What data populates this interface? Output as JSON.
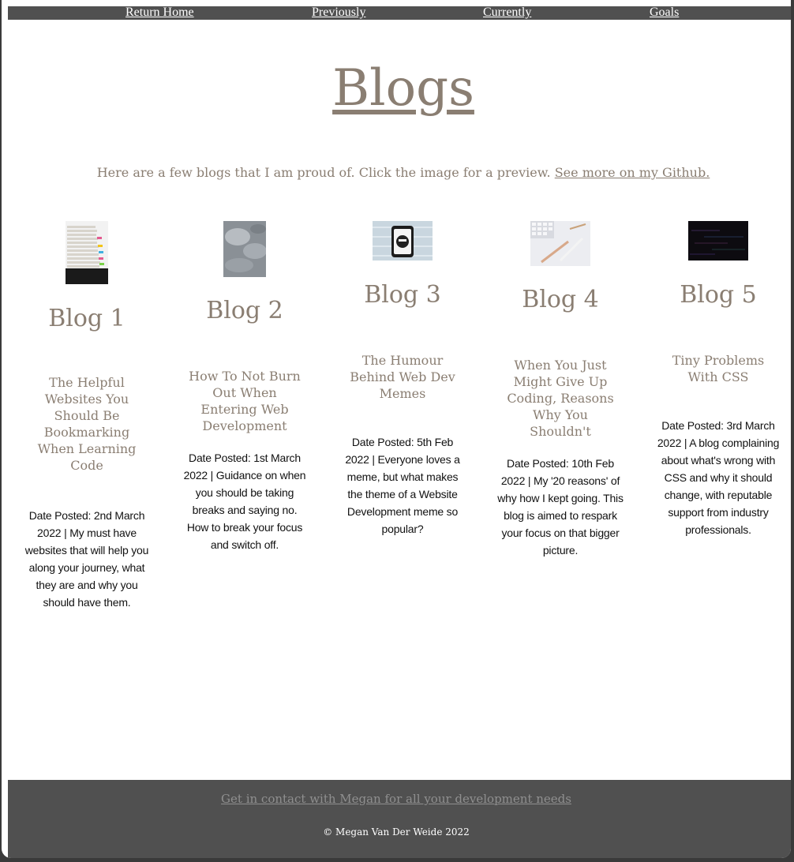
{
  "nav": {
    "home": "Return Home",
    "previously": "Previously",
    "currently": "Currently",
    "goals": "Goals"
  },
  "page": {
    "title": "Blogs",
    "intro": "Here are a few blogs that I am proud of. Click the image for a preview.",
    "github_link": "See more on my Github."
  },
  "blogs": [
    {
      "heading": "Blog 1",
      "title": "The Helpful Websites You Should Be Bookmarking When Learning Code",
      "description": "Date Posted: 2nd March 2022 | My must have websites that will help you along your journey, what they are and why you should have them.",
      "image": "stacked-papers-with-sticky-notes"
    },
    {
      "heading": "Blog 2",
      "title": "How To Not Burn Out When Entering Web Development",
      "description": "Date Posted: 1st March 2022 | Guidance on when you should be taking breaks and saying no. How to break your focus and switch off.",
      "image": "cloudy-grey-sky"
    },
    {
      "heading": "Blog 3",
      "title": "The Humour Behind Web Dev Memes",
      "description": "Date Posted: 5th Feb 2022 | Everyone loves a meme, but what makes the theme of a Website Development meme so popular?",
      "image": "phone-with-emoji"
    },
    {
      "heading": "Blog 4",
      "title": "When You Just Might Give Up Coding, Reasons Why You Shouldn't",
      "description": "Date Posted: 10th Feb 2022 | My '20 reasons' of why how I kept going. This blog is aimed to respark your focus on that bigger picture.",
      "image": "keyboard-and-pens-on-desk"
    },
    {
      "heading": "Blog 5",
      "title": "Tiny Problems With CSS",
      "description": "Date Posted: 3rd March 2022 | A blog complaining about what's wrong with CSS and why it should change, with reputable support from industry professionals.",
      "image": "dark-glitch-screen"
    }
  ],
  "footer": {
    "contact": "Get in contact with Megan for all your development needs",
    "copyright": "© Megan Van Der Weide 2022"
  }
}
